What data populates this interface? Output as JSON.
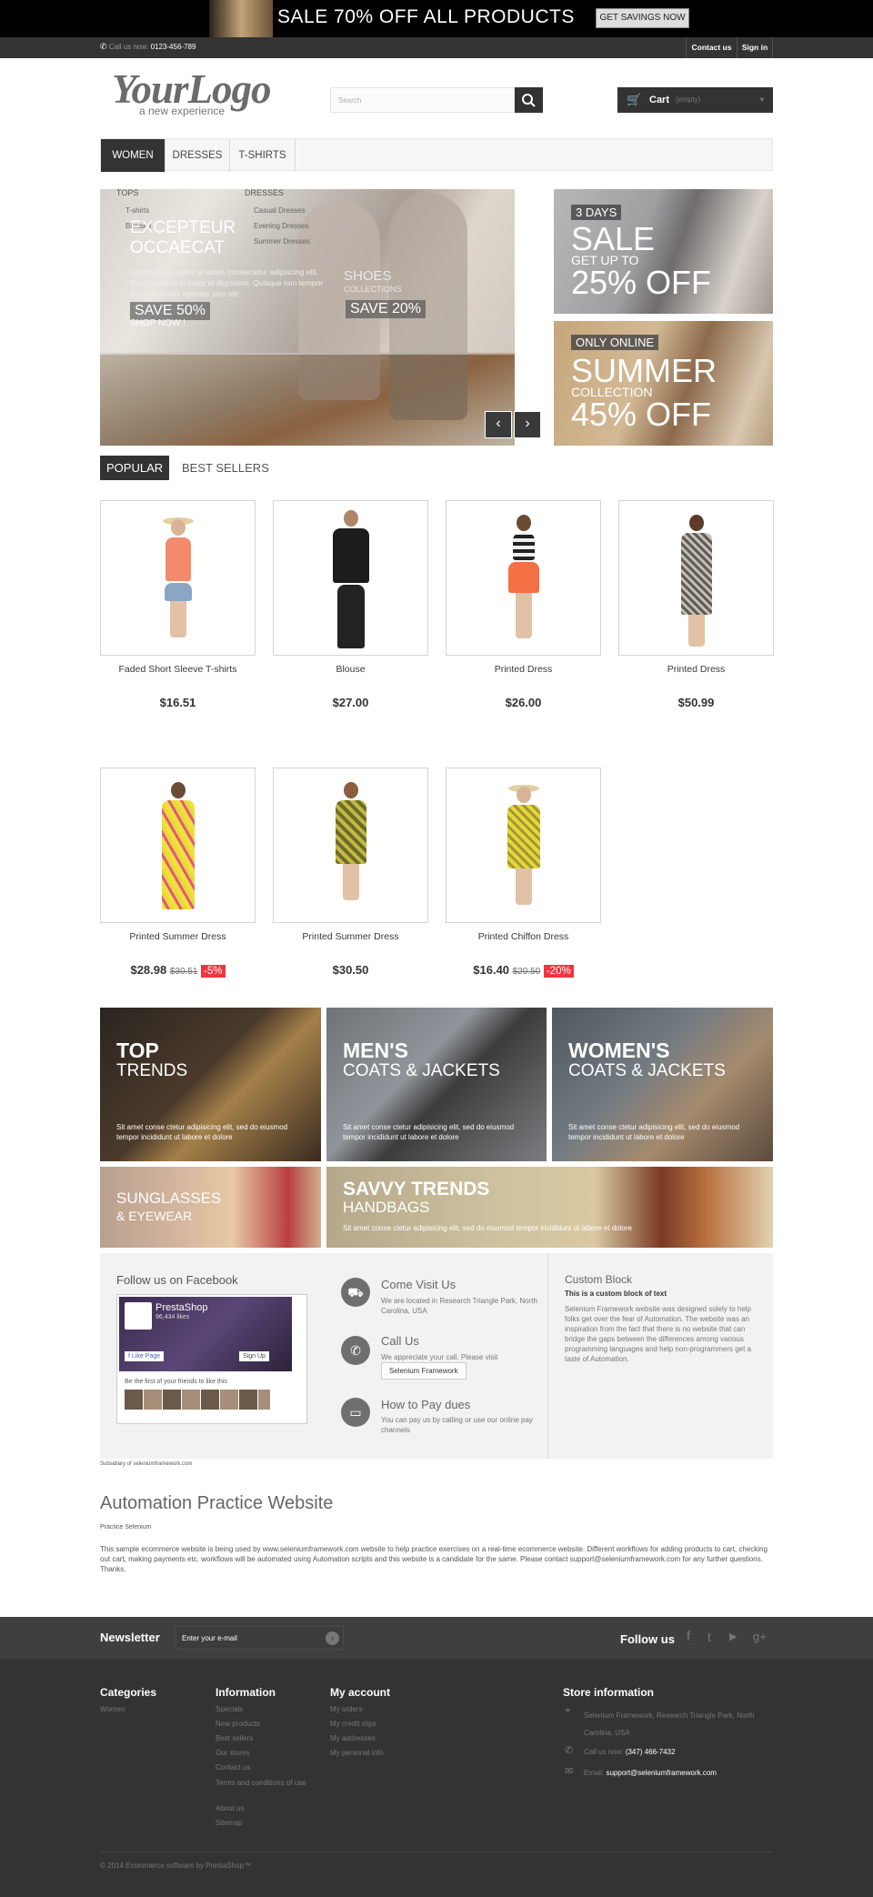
{
  "top_banner": {
    "text": "SALE 70% OFF ALL PRODUCTS",
    "button": "GET SAVINGS NOW"
  },
  "nav": {
    "call_label": "Call us now:",
    "phone": "0123-456-789",
    "contact": "Contact us",
    "signin": "Sign in"
  },
  "logo": {
    "main": "YourLogo",
    "tagline": "a new experience"
  },
  "search": {
    "placeholder": "Search"
  },
  "cart": {
    "label": "Cart",
    "status": "(empty)"
  },
  "menu": {
    "items": [
      "WOMEN",
      "DRESSES",
      "T-SHIRTS"
    ]
  },
  "dropdown": {
    "col1_head": "TOPS",
    "col1_items": [
      "T-shirts",
      "Blouses"
    ],
    "col2_head": "DRESSES",
    "col2_items": [
      "Casual Dresses",
      "Evening Dresses",
      "Summer Dresses"
    ]
  },
  "slider": {
    "title_line1": "EXCEPTEUR",
    "title_line2": "OCCAECAT",
    "text": "Lorem ipsum dolor sit amet, consectetur adipiscing elit. Proin tristique in tortor et dignissim. Quisque non tempor leo. Maecenas egestas sem elit",
    "save1": "SAVE 50%",
    "shop_now": "SHOP NOW !",
    "overlay_line1": "SHOES",
    "overlay_line2": "COLLECTIONS",
    "save2": "SAVE 20%",
    "prev": "‹",
    "next": "›"
  },
  "promos": [
    {
      "tag": "3 DAYS",
      "big": "SALE",
      "small": "GET UP TO",
      "big2": "25% OFF"
    },
    {
      "tag": "ONLY ONLINE",
      "big": "SUMMER",
      "small": "COLLECTION",
      "big2": "45% OFF"
    }
  ],
  "tabs": {
    "popular": "POPULAR",
    "best": "BEST SELLERS"
  },
  "products": [
    {
      "name": "Faded Short Sleeve T-shirts",
      "price": "$16.51",
      "old": "",
      "disc": ""
    },
    {
      "name": "Blouse",
      "price": "$27.00",
      "old": "",
      "disc": ""
    },
    {
      "name": "Printed Dress",
      "price": "$26.00",
      "old": "",
      "disc": ""
    },
    {
      "name": "Printed Dress",
      "price": "$50.99",
      "old": "",
      "disc": ""
    },
    {
      "name": "Printed Summer Dress",
      "price": "$28.98",
      "old": "$30.51",
      "disc": "-5%"
    },
    {
      "name": "Printed Summer Dress",
      "price": "$30.50",
      "old": "",
      "disc": ""
    },
    {
      "name": "Printed Chiffon Dress",
      "price": "$16.40",
      "old": "$20.50",
      "disc": "-20%"
    }
  ],
  "banners": {
    "b1_t1": "TOP",
    "b1_t2": "TRENDS",
    "b1_txt": "Sit amet conse ctetur adipisicing elit, sed do eiusmod tempor incididunt ut labore et dolore",
    "b2_t1": "MEN'S",
    "b2_t2": "COATS & JACKETS",
    "b2_txt": "Sit amet conse ctetur adipisicing elit, sed do eiusmod tempor incididunt ut labore et dolore",
    "b3_t1": "WOMEN'S",
    "b3_t2": "COATS & JACKETS",
    "b3_txt": "Sit amet conse ctetur adipisicing elit, sed do eiusmod tempor incididunt ut labore et dolore",
    "b4_t1": "SUNGLASSES",
    "b4_t2": "& EYEWEAR",
    "b5_t1": "SAVVY TRENDS",
    "b5_t2": "HANDBAGS",
    "b5_txt": "Sit amet conse ctetur adipisicing elit, sed do eiusmod tempor incididunt ut labore et dolore"
  },
  "facebook": {
    "title": "Follow us on Facebook",
    "page": "PrestaShop",
    "likes": "96,434 likes",
    "like_btn": "Like Page",
    "signup": "Sign Up",
    "friends": "Be the first of your friends to like this"
  },
  "contact_info": {
    "visit_title": "Come Visit Us",
    "visit_text": "We are located in Research Triangle Park, North Carolina, USA",
    "call_title": "Call Us",
    "call_text": "We appreciate your call. Please visit",
    "call_btn": "Selenium Framework",
    "pay_title": "How to Pay dues",
    "pay_text": "You can pay us by calling or use our online pay channels"
  },
  "custom_block": {
    "title": "Custom Block",
    "subtitle": "This is a custom block of text",
    "text": "Selenium Framework website was designed solely to help folks get over the fear of Automation. The website was an inspiration from the fact that there is no website that can bridge the gaps between the differences among various programming languages and help non-programmers get a taste of Automation."
  },
  "subsidiary": "Subsidiary of seleniumframework.com",
  "about": {
    "title": "Automation Practice Website",
    "sub": "Practice Selenium",
    "text": "This sample ecommerce website is being used by www.seleniumframework.com website to help practice exercises on a real-time ecommerce website. Different workflows for adding products to cart, checking out cart, making payments etc. workflows will be automated using Automation scripts and this website is a candidate for the same. Please contact support@seleniumframework.com for any further questions. Thanks."
  },
  "newsletter": {
    "title": "Newsletter",
    "placeholder": "Enter your e-mail",
    "follow": "Follow us"
  },
  "footer": {
    "categories_title": "Categories",
    "categories": [
      "Women"
    ],
    "info_title": "Information",
    "info": [
      "Specials",
      "New products",
      "Best sellers",
      "Our stores",
      "Contact us",
      "Terms and conditions of use",
      "About us",
      "Sitemap"
    ],
    "account_title": "My account",
    "account": [
      "My orders",
      "My credit slips",
      "My addresses",
      "My personal info"
    ],
    "store_title": "Store information",
    "store_address": "Selenium Framework, Research Triangle Park, North Carolina, USA",
    "store_call_label": "Call us now:",
    "store_phone": "(347) 466-7432",
    "store_email_label": "Email:",
    "store_email": "support@seleniumframework.com",
    "copyright": "© 2014 Ecommerce software by PrestaShop™"
  },
  "colors": {
    "dark": "#333333",
    "discount": "#f13340"
  }
}
